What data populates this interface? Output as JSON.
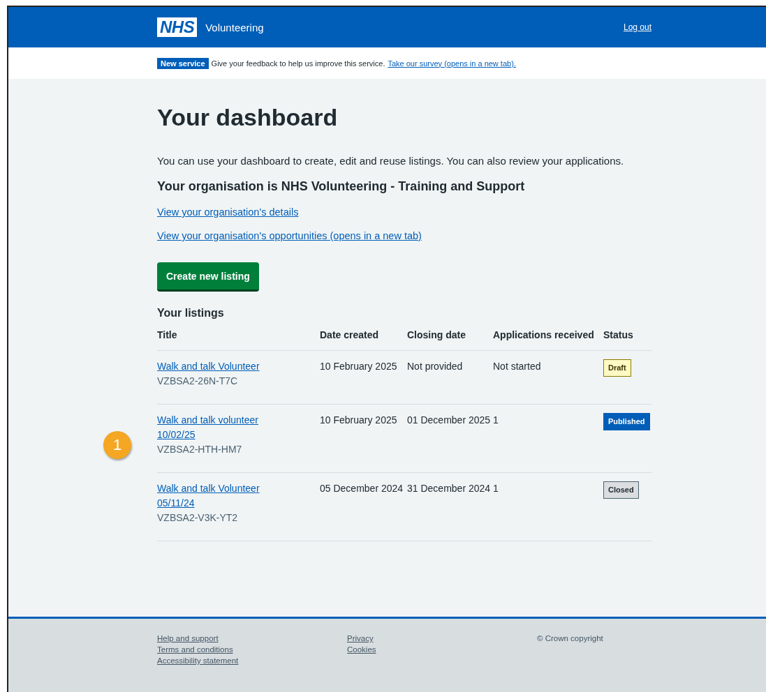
{
  "header": {
    "logo": "NHS",
    "service_name": "Volunteering",
    "logout_link": "Log out"
  },
  "banner": {
    "tag": "New service",
    "text": "Give your feedback to help us improve this service.",
    "link": "Take our survey (opens in a new tab)."
  },
  "main": {
    "heading": "Your dashboard",
    "intro": "You can use your dashboard to create, edit and reuse listings. You can also review your applications.",
    "organisation_heading": "Your organisation is NHS Volunteering - Training and Support",
    "links": [
      "View your organisation's details",
      "View your organisation's opportunities (opens in a new tab)"
    ],
    "create_button": "Create new listing",
    "listings_heading": "Your listings",
    "table": {
      "columns": [
        "Title",
        "Date created",
        "Closing date",
        "Applications received",
        "Status"
      ],
      "rows": [
        {
          "title": "Walk and talk Volunteer",
          "reference": "VZBSA2-26N-T7C",
          "date_created": "10 February 2025",
          "closing_date": "Not provided",
          "applications": "Not started",
          "status": {
            "label": "Draft",
            "kind": "draft"
          }
        },
        {
          "title": "Walk and talk volunteer 10/02/25",
          "reference": "VZBSA2-HTH-HM7",
          "date_created": "10 February 2025",
          "closing_date": "01 December 2025",
          "applications": "1",
          "status": {
            "label": "Published",
            "kind": "published"
          }
        },
        {
          "title": "Walk and talk Volunteer 05/11/24",
          "reference": "VZBSA2-V3K-YT2",
          "date_created": "05 December 2024",
          "closing_date": "31 December 2024",
          "applications": "1",
          "status": {
            "label": "Closed",
            "kind": "closed"
          }
        }
      ]
    }
  },
  "callout": "1",
  "footer": {
    "columns": [
      [
        "Help and support",
        "Terms and conditions",
        "Accessibility statement"
      ],
      [
        "Privacy",
        "Cookies"
      ]
    ],
    "copyright": "© Crown copyright"
  }
}
